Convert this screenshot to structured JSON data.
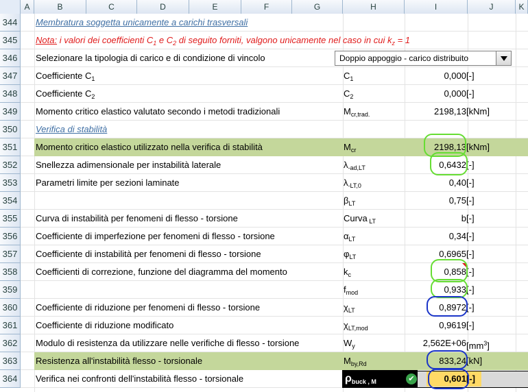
{
  "columns": [
    "A",
    "B",
    "C",
    "D",
    "E",
    "F",
    "G",
    "H",
    "I",
    "J",
    "K"
  ],
  "rows": [
    "344",
    "345",
    "346",
    "347",
    "348",
    "349",
    "350",
    "351",
    "352",
    "353",
    "354",
    "355",
    "356",
    "357",
    "358",
    "359",
    "360",
    "361",
    "362",
    "363",
    "364"
  ],
  "sheet": {
    "r344": {
      "b": "Membratura soggetta unicamente a carichi trasversali"
    },
    "r345": {
      "note_prefix": "Nota:",
      "note_text": " i valori dei coefficienti C",
      "sub1": "1",
      "mid": " e C",
      "sub2": "2",
      "rest": " di seguito forniti, valgono unicamente nel caso in cui k",
      "subz": "z",
      "end": " = 1"
    },
    "r346": {
      "b": "Selezionare la tipologia di carico e di condizione di vincolo",
      "dropdown": "Doppio appoggio - carico distribuito"
    },
    "r347": {
      "b": "Coefficiente C",
      "b_sub": "1",
      "h": "C",
      "h_sub": "1",
      "val": "0,000",
      "unit": "[-]"
    },
    "r348": {
      "b": "Coefficiente C",
      "b_sub": "2",
      "h": "C",
      "h_sub": "2",
      "val": "0,000",
      "unit": "[-]"
    },
    "r349": {
      "b": "Momento critico elastico valutato secondo i metodi tradizionali",
      "h": "M",
      "h_sub": "cr,trad.",
      "val": "2198,13",
      "unit": "[kNm]"
    },
    "r350": {
      "b": "Verifica di stabilità"
    },
    "r351": {
      "b": "Momento critico elastico utilizzato nella verifica di stabilità",
      "h": "M",
      "h_sub": "cr",
      "val": "2198,13",
      "unit": "[kNm]"
    },
    "r352": {
      "b": "Snellezza adimensionale per instabilità laterale",
      "h": "λ",
      "h_sub": "-ad,LT",
      "val": "0,6432",
      "unit": "[-]"
    },
    "r353": {
      "b": "Parametri limite per sezioni laminate",
      "h": "λ",
      "h_sub": "-LT,0",
      "val": "0,40",
      "unit": "[-]"
    },
    "r354": {
      "h": "β",
      "h_sub": "LT",
      "val": "0,75",
      "unit": "[-]"
    },
    "r355": {
      "b": "Curva di instabilità per fenomeni di flesso - torsione",
      "h": "Curva",
      "h_sub": " LT",
      "val": "b",
      "unit": "[-]"
    },
    "r356": {
      "b": "Coefficiente di imperfezione per fenomeni di flesso - torsione",
      "h": "α",
      "h_sub": "LT",
      "val": "0,34",
      "unit": "[-]"
    },
    "r357": {
      "b": "Coefficiente di instabilità per fenomeni di flesso - torsione",
      "h": "φ",
      "h_sub": "LT",
      "val": "0,6965",
      "unit": "[-]"
    },
    "r358": {
      "b": "Coefficienti di correzione, funzione del diagramma del momento",
      "h": "k",
      "h_sub": "c",
      "val": "0,858",
      "unit": "[-]"
    },
    "r359": {
      "h": "f",
      "h_sub": "mod",
      "val": "0,933",
      "unit": "[-]"
    },
    "r360": {
      "b": "Coefficiente di riduzione per fenomeni di flesso - torsione",
      "h": "χ",
      "h_sub": "LT",
      "val": "0,8972",
      "unit": "[-]"
    },
    "r361": {
      "b": "Coefficiente di riduzione modificato",
      "h": "χ",
      "h_sub": "LT,mod",
      "val": "0,9619",
      "unit": "[-]"
    },
    "r362": {
      "b": "Modulo di resistenza da utilizzare nelle verifiche di flesso - torsione",
      "h": "W",
      "h_sub": "y",
      "val": "2,562E+06",
      "unit": "[mm",
      "unit_sup": "3",
      "unit_end": "]"
    },
    "r363": {
      "b": "Resistenza all'instabilità flesso - torsionale",
      "h": "M",
      "h_sub": "by,Rd",
      "val": "833,24",
      "unit": "[kN]"
    },
    "r364": {
      "b": "Verifica nei confronti dell'instabilità flesso - torsionale",
      "h": "ρ",
      "h_sub": "buck , M",
      "val": "0,601",
      "unit": "[-]",
      "check_icon": "check-circle-icon"
    }
  },
  "colors": {
    "highlight_green": "#c4d79b",
    "ring_green": "#66dd33",
    "ring_blue": "#1a34c8",
    "result_yellow": "#ffd966"
  }
}
